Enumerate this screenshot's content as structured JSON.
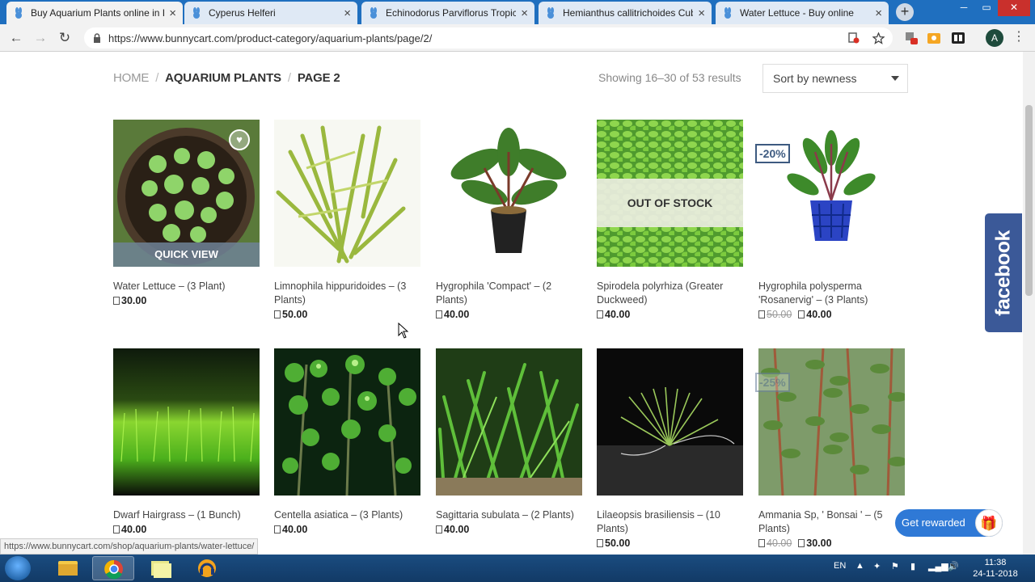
{
  "browser": {
    "tabs": [
      {
        "title": "Buy Aquarium Plants online in I",
        "active": true
      },
      {
        "title": "Cyperus Helferi",
        "active": false
      },
      {
        "title": "Echinodorus Parviflorus Tropica",
        "active": false
      },
      {
        "title": "Hemianthus callitrichoides Cub",
        "active": false
      },
      {
        "title": "Water Lettuce - Buy online",
        "active": false
      }
    ],
    "url": "https://www.bunnycart.com/product-category/aquarium-plants/page/2/",
    "avatar_letter": "A",
    "status_url": "https://www.bunnycart.com/shop/aquarium-plants/water-lettuce/"
  },
  "breadcrumb": {
    "home": "HOME",
    "category": "AQUARIUM PLANTS",
    "current": "PAGE 2",
    "separator": "/"
  },
  "results_text": "Showing 16–30 of 53 results",
  "sort": {
    "selected": "Sort by newness"
  },
  "products": [
    {
      "name": "Water Lettuce – (3 Plant)",
      "price": "30.00",
      "quick_view": "QUICK VIEW"
    },
    {
      "name": "Limnophila hippuridoides – (3 Plants)",
      "price": "50.00"
    },
    {
      "name": "Hygrophila 'Compact' – (2 Plants)",
      "price": "40.00"
    },
    {
      "name": "Spirodela polyrhiza (Greater Duckweed)",
      "price": "40.00",
      "stock_label": "OUT OF STOCK"
    },
    {
      "name": "Hygrophila polysperma 'Rosanervig' – (3 Plants)",
      "old_price": "50.00",
      "price": "40.00",
      "badge": "-20%"
    },
    {
      "name": "Dwarf Hairgrass – (1 Bunch)",
      "price": "40.00"
    },
    {
      "name": "Centella asiatica – (3 Plants)",
      "price": "40.00"
    },
    {
      "name": "Sagittaria subulata – (2 Plants)",
      "price": "40.00"
    },
    {
      "name": "Lilaeopsis brasiliensis – (10 Plants)",
      "price": "50.00"
    },
    {
      "name": "Ammania Sp, ' Bonsai ' – (5 Plants)",
      "old_price": "40.00",
      "price": "30.00",
      "badge": "-25%"
    }
  ],
  "facebook_label": "facebook",
  "rewards_label": "Get rewarded",
  "taskbar": {
    "lang": "EN",
    "time": "11:38",
    "date": "24-11-2018"
  },
  "colors": {
    "accent": "#3d5a80",
    "facebook": "#3b5998",
    "rewards": "#2f79d6",
    "tabbar": "#1f6fbf"
  }
}
